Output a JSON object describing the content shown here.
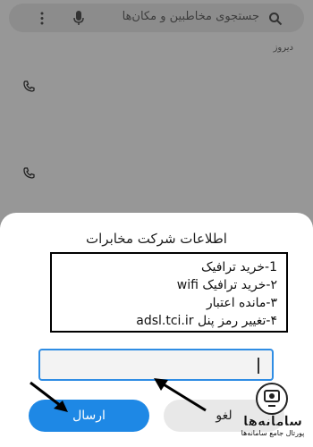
{
  "search": {
    "placeholder": "جستجوی مخاطبین و مکان‌ها"
  },
  "history": {
    "section_label": "دیروز"
  },
  "dialog": {
    "title": "اطلاعات شرکت مخابرات",
    "menu_items": [
      "1-خرید ترافیک",
      "۲-خرید ترافیک wifi",
      "۳-مانده اعتبار",
      "۴-تغییر رمز پنل adsl.tci.ir"
    ],
    "input_value": "",
    "send_label": "ارسال",
    "cancel_label": "لغو"
  },
  "colors": {
    "primary": "#1e88e5",
    "input_border": "#2f8de4",
    "overlay": "#979797"
  },
  "watermark": {
    "title": "سامانه‌ها",
    "subtitle": "پورتال جامع سامانه‌ها"
  }
}
